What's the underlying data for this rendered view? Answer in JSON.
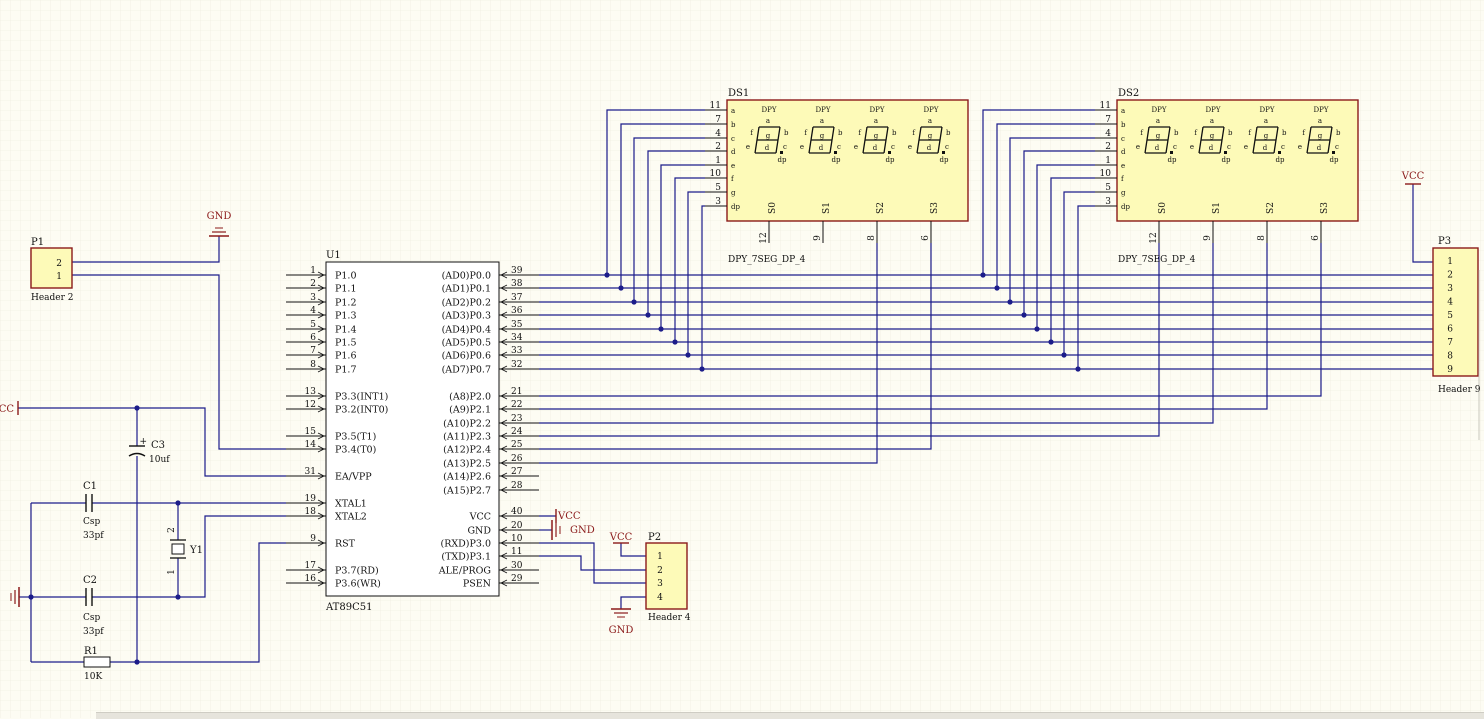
{
  "mcu": {
    "designator": "U1",
    "part": "AT89C51",
    "left_pins": [
      {
        "num": "1",
        "label": "P1.0"
      },
      {
        "num": "2",
        "label": "P1.1"
      },
      {
        "num": "3",
        "label": "P1.2"
      },
      {
        "num": "4",
        "label": "P1.3"
      },
      {
        "num": "5",
        "label": "P1.4"
      },
      {
        "num": "6",
        "label": "P1.5"
      },
      {
        "num": "7",
        "label": "P1.6"
      },
      {
        "num": "8",
        "label": "P1.7"
      },
      {
        "num": "13",
        "label": "P3.3(INT1)"
      },
      {
        "num": "12",
        "label": "P3.2(INT0)"
      },
      {
        "num": "15",
        "label": "P3.5(T1)"
      },
      {
        "num": "14",
        "label": "P3.4(T0)"
      },
      {
        "num": "31",
        "label": "EA/VPP"
      },
      {
        "num": "19",
        "label": "XTAL1"
      },
      {
        "num": "18",
        "label": "XTAL2"
      },
      {
        "num": "9",
        "label": "RST"
      },
      {
        "num": "17",
        "label": "P3.7(RD)"
      },
      {
        "num": "16",
        "label": "P3.6(WR)"
      }
    ],
    "right_pins": [
      {
        "num": "39",
        "label": "(AD0)P0.0"
      },
      {
        "num": "38",
        "label": "(AD1)P0.1"
      },
      {
        "num": "37",
        "label": "(AD2)P0.2"
      },
      {
        "num": "36",
        "label": "(AD3)P0.3"
      },
      {
        "num": "35",
        "label": "(AD4)P0.4"
      },
      {
        "num": "34",
        "label": "(AD5)P0.5"
      },
      {
        "num": "33",
        "label": "(AD6)P0.6"
      },
      {
        "num": "32",
        "label": "(AD7)P0.7"
      },
      {
        "num": "21",
        "label": "(A8)P2.0"
      },
      {
        "num": "22",
        "label": "(A9)P2.1"
      },
      {
        "num": "23",
        "label": "(A10)P2.2"
      },
      {
        "num": "24",
        "label": "(A11)P2.3"
      },
      {
        "num": "25",
        "label": "(A12)P2.4"
      },
      {
        "num": "26",
        "label": "(A13)P2.5"
      },
      {
        "num": "27",
        "label": "(A14)P2.6"
      },
      {
        "num": "28",
        "label": "(A15)P2.7"
      },
      {
        "num": "40",
        "label": "VCC"
      },
      {
        "num": "20",
        "label": "GND"
      },
      {
        "num": "10",
        "label": "(RXD)P3.0"
      },
      {
        "num": "11",
        "label": "(TXD)P3.1"
      },
      {
        "num": "30",
        "label": "ALE/PROG"
      },
      {
        "num": "29",
        "label": "PSEN"
      }
    ]
  },
  "displays": [
    {
      "designator": "DS1",
      "part": "DPY_7SEG_DP_4"
    },
    {
      "designator": "DS2",
      "part": "DPY_7SEG_DP_4"
    }
  ],
  "display_pins": {
    "left": [
      {
        "num": "11",
        "seg": "a"
      },
      {
        "num": "7",
        "seg": "b"
      },
      {
        "num": "4",
        "seg": "c"
      },
      {
        "num": "2",
        "seg": "d"
      },
      {
        "num": "1",
        "seg": "e"
      },
      {
        "num": "10",
        "seg": "f"
      },
      {
        "num": "5",
        "seg": "g"
      },
      {
        "num": "3",
        "seg": "dp"
      }
    ],
    "digits": [
      {
        "title": "DPY",
        "sel": "S0",
        "pin": "12"
      },
      {
        "title": "DPY",
        "sel": "S1",
        "pin": "9"
      },
      {
        "title": "DPY",
        "sel": "S2",
        "pin": "8"
      },
      {
        "title": "DPY",
        "sel": "S3",
        "pin": "6"
      }
    ],
    "seg_letters": {
      "a": "a",
      "b": "b",
      "c": "c",
      "d": "d",
      "e": "e",
      "f": "f",
      "g": "g",
      "dp": "dp"
    }
  },
  "headers": [
    {
      "designator": "P1",
      "comment": "Header 2",
      "pins": [
        "2",
        "1"
      ]
    },
    {
      "designator": "P2",
      "comment": "Header 4",
      "pins": [
        "1",
        "2",
        "3",
        "4"
      ]
    },
    {
      "designator": "P3",
      "comment": "Header 9",
      "pins": [
        "1",
        "2",
        "3",
        "4",
        "5",
        "6",
        "7",
        "8",
        "9"
      ]
    }
  ],
  "components": {
    "c1": {
      "designator": "C1",
      "comment": "Csp",
      "value": "33pf"
    },
    "c2": {
      "designator": "C2",
      "comment": "Csp",
      "value": "33pf"
    },
    "c3": {
      "designator": "C3",
      "value": "10uf",
      "polarity": "+"
    },
    "r1": {
      "designator": "R1",
      "value": "10K"
    },
    "y1": {
      "designator": "Y1",
      "pin_top": "2",
      "pin_bottom": "1"
    }
  },
  "power": {
    "gnd_top": "GND",
    "gnd_mcu": "GND",
    "gnd_p2": "GND",
    "vcc_mcu": "VCC",
    "vcc_p2": "VCC",
    "vcc_p3": "VCC",
    "vcc_left": "VCC"
  },
  "colors": {
    "background": "#fdfcf3",
    "grid": "#ece9dc",
    "wire": "#1c1c8a",
    "component_fill": "#fdfab8",
    "component_border": "#8b1a1a",
    "power": "#8b1a1a",
    "pin": "#111111",
    "junction": "#1c1c8a"
  }
}
